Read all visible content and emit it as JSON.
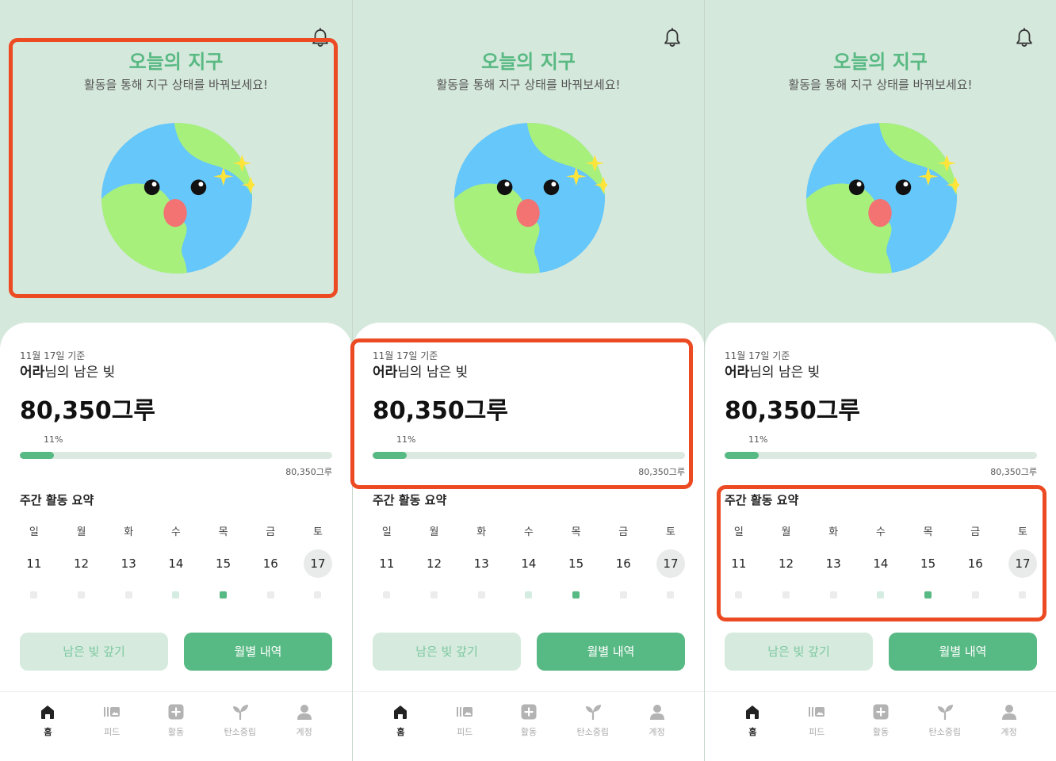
{
  "screen": {
    "title": "오늘의 지구",
    "subtitle": "활동을 통해 지구 상태를 바꿔보세요!",
    "notification_icon": "bell-icon"
  },
  "summary": {
    "date_label": "11월 17일 기준",
    "user_name": "어라",
    "remaining_suffix": "님의 남은 빚",
    "amount": "80,350그루",
    "progress_label": "11%",
    "progress_value": 0.11,
    "total_label": "80,350그루"
  },
  "weekly": {
    "title": "주간 활동 요약",
    "days": [
      {
        "dow": "일",
        "num": "11",
        "selected": false,
        "level": 0
      },
      {
        "dow": "월",
        "num": "12",
        "selected": false,
        "level": 0
      },
      {
        "dow": "화",
        "num": "13",
        "selected": false,
        "level": 0
      },
      {
        "dow": "수",
        "num": "14",
        "selected": false,
        "level": 1
      },
      {
        "dow": "목",
        "num": "15",
        "selected": false,
        "level": 2
      },
      {
        "dow": "금",
        "num": "16",
        "selected": false,
        "level": 0
      },
      {
        "dow": "토",
        "num": "17",
        "selected": true,
        "level": 0
      }
    ]
  },
  "actions": {
    "pay_label": "남은 빚 갚기",
    "monthly_label": "월별 내역"
  },
  "tabs": [
    {
      "label": "홈",
      "icon": "home-icon",
      "active": true
    },
    {
      "label": "피드",
      "icon": "feed-icon",
      "active": false
    },
    {
      "label": "활동",
      "icon": "add-activity-icon",
      "active": false
    },
    {
      "label": "탄소중립",
      "icon": "sprout-icon",
      "active": false
    },
    {
      "label": "계정",
      "icon": "account-icon",
      "active": false
    }
  ],
  "colors": {
    "accent": "#57b983",
    "background": "#d5e8dc",
    "highlight": "#ec4a23",
    "dot_low": "#d4ede0",
    "dot_high": "#57b983",
    "dot_empty": "#ececec"
  },
  "highlights": [
    "earth-section",
    "debt-summary",
    "weekly-summary"
  ]
}
